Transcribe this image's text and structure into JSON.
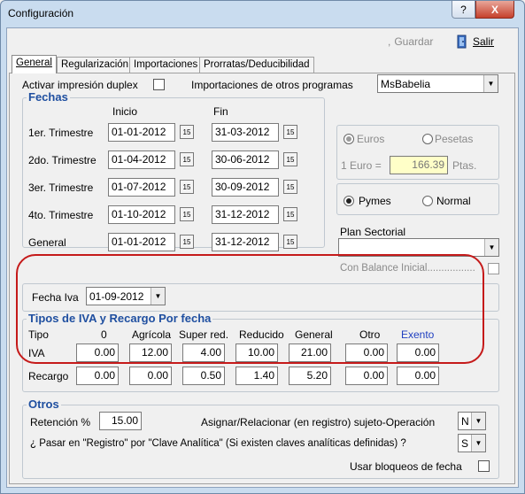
{
  "window": {
    "title": "Configuración",
    "help": "?",
    "close": "X"
  },
  "toolbar": {
    "guardar": "Guardar",
    "salir": "Salir"
  },
  "tabs": [
    "General",
    "Regularización",
    "Importaciones",
    "Prorratas/Deducibilidad"
  ],
  "top": {
    "duplex_label": "Activar impresión duplex",
    "import_label": "Importaciones  de otros programas",
    "import_value": "MsBabelia"
  },
  "fechas": {
    "legend": "Fechas",
    "col_inicio": "Inicio",
    "col_fin": "Fin",
    "rows": [
      {
        "label": "1er. Trimestre",
        "inicio": "01-01-2012",
        "fin": "31-03-2012"
      },
      {
        "label": "2do. Trimestre",
        "inicio": "01-04-2012",
        "fin": "30-06-2012"
      },
      {
        "label": "3er. Trimestre",
        "inicio": "01-07-2012",
        "fin": "30-09-2012"
      },
      {
        "label": "4to. Trimestre",
        "inicio": "01-10-2012",
        "fin": "31-12-2012"
      },
      {
        "label": "General",
        "inicio": "01-01-2012",
        "fin": "31-12-2012"
      }
    ],
    "cal_icon": "15"
  },
  "moneda": {
    "euros": "Euros",
    "pesetas": "Pesetas",
    "euro_eq_label": "1 Euro =",
    "euro_eq_value": "166.39",
    "ptas": "Ptas."
  },
  "empresa": {
    "pymes": "Pymes",
    "normal": "Normal"
  },
  "plan": {
    "label": "Plan Sectorial",
    "value": "",
    "balance_label": "Con Balance Inicial................."
  },
  "fecha_iva": {
    "label": "Fecha Iva",
    "value": "01-09-2012"
  },
  "iva": {
    "legend": "Tipos de IVA y Recargo Por fecha",
    "headers": [
      "Tipo",
      "0",
      "Agrícola",
      "Super red.",
      "Reducido",
      "General",
      "Otro",
      "Exento"
    ],
    "rows": [
      {
        "label": "IVA",
        "values": [
          "0.00",
          "12.00",
          "4.00",
          "10.00",
          "21.00",
          "0.00",
          "0.00"
        ]
      },
      {
        "label": "Recargo",
        "values": [
          "0.00",
          "0.00",
          "0.50",
          "1.40",
          "5.20",
          "0.00",
          "0.00"
        ]
      }
    ]
  },
  "otros": {
    "legend": "Otros",
    "retencion_label": "Retención %",
    "retencion_value": "15.00",
    "asignar_label": "Asignar/Relacionar (en registro) sujeto-Operación",
    "asignar_value": "N",
    "pasar_label": "¿ Pasar en \"Registro\" por \"Clave Analítica\" (Si existen claves analíticas definidas) ?",
    "pasar_value": "S",
    "bloqueos_label": "Usar bloqueos de fecha"
  }
}
